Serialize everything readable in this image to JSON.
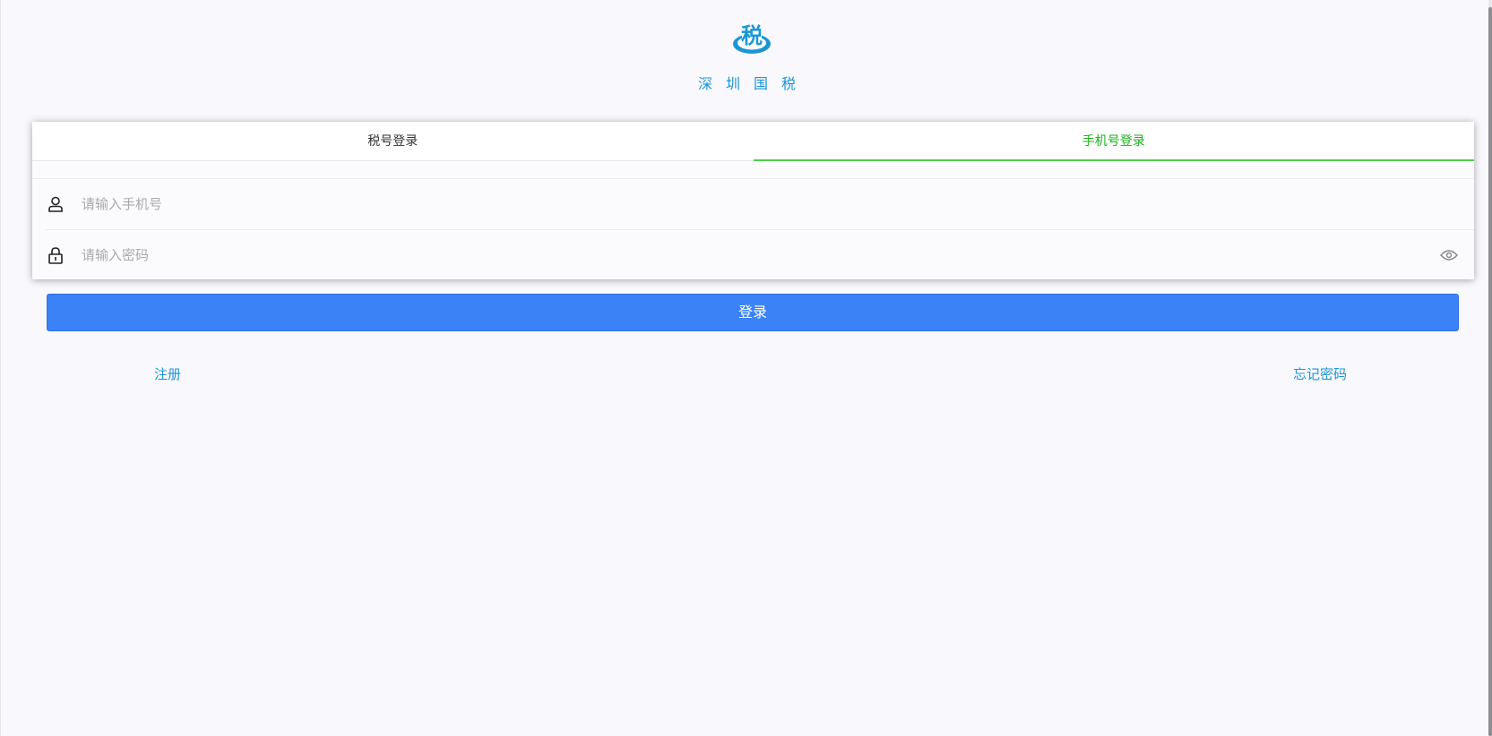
{
  "brand": {
    "logo_char": "税",
    "name": "深圳国税",
    "color": "#1a96d4"
  },
  "tabs": [
    {
      "label": "税号登录",
      "active": false
    },
    {
      "label": "手机号登录",
      "active": true
    }
  ],
  "form": {
    "phone": {
      "icon": "user-icon",
      "placeholder": "请输入手机号",
      "value": ""
    },
    "password": {
      "icon": "lock-icon",
      "placeholder": "请输入密码",
      "value": "",
      "toggle_icon": "eye-icon"
    }
  },
  "actions": {
    "login_label": "登录",
    "register_label": "注册",
    "forgot_label": "忘记密码"
  },
  "colors": {
    "active_tab": "#17b317",
    "primary_button": "#3b82f6",
    "link": "#1a96d4"
  }
}
